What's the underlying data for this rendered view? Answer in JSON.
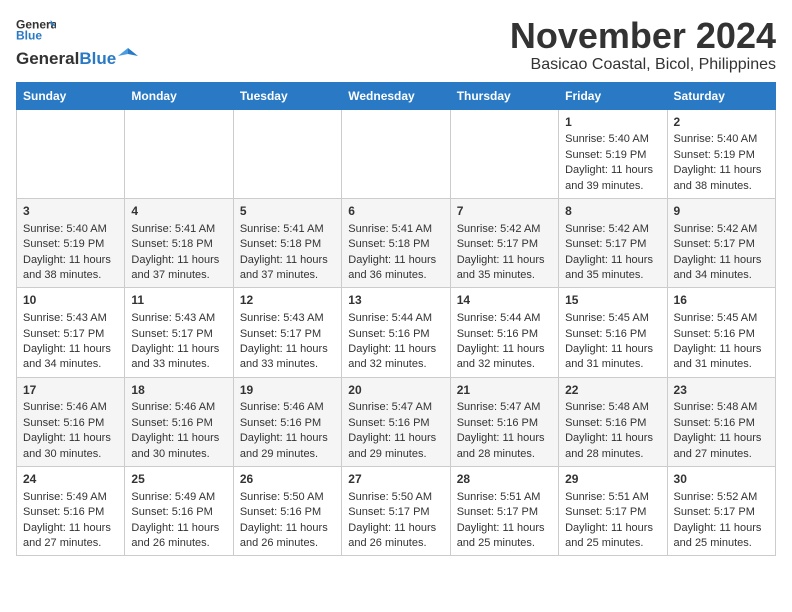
{
  "header": {
    "logo_line1": "General",
    "logo_line2": "Blue",
    "month_year": "November 2024",
    "location": "Basicao Coastal, Bicol, Philippines"
  },
  "weekdays": [
    "Sunday",
    "Monday",
    "Tuesday",
    "Wednesday",
    "Thursday",
    "Friday",
    "Saturday"
  ],
  "weeks": [
    [
      {
        "day": "",
        "info": ""
      },
      {
        "day": "",
        "info": ""
      },
      {
        "day": "",
        "info": ""
      },
      {
        "day": "",
        "info": ""
      },
      {
        "day": "",
        "info": ""
      },
      {
        "day": "1",
        "info": "Sunrise: 5:40 AM\nSunset: 5:19 PM\nDaylight: 11 hours and 39 minutes."
      },
      {
        "day": "2",
        "info": "Sunrise: 5:40 AM\nSunset: 5:19 PM\nDaylight: 11 hours and 38 minutes."
      }
    ],
    [
      {
        "day": "3",
        "info": "Sunrise: 5:40 AM\nSunset: 5:19 PM\nDaylight: 11 hours and 38 minutes."
      },
      {
        "day": "4",
        "info": "Sunrise: 5:41 AM\nSunset: 5:18 PM\nDaylight: 11 hours and 37 minutes."
      },
      {
        "day": "5",
        "info": "Sunrise: 5:41 AM\nSunset: 5:18 PM\nDaylight: 11 hours and 37 minutes."
      },
      {
        "day": "6",
        "info": "Sunrise: 5:41 AM\nSunset: 5:18 PM\nDaylight: 11 hours and 36 minutes."
      },
      {
        "day": "7",
        "info": "Sunrise: 5:42 AM\nSunset: 5:17 PM\nDaylight: 11 hours and 35 minutes."
      },
      {
        "day": "8",
        "info": "Sunrise: 5:42 AM\nSunset: 5:17 PM\nDaylight: 11 hours and 35 minutes."
      },
      {
        "day": "9",
        "info": "Sunrise: 5:42 AM\nSunset: 5:17 PM\nDaylight: 11 hours and 34 minutes."
      }
    ],
    [
      {
        "day": "10",
        "info": "Sunrise: 5:43 AM\nSunset: 5:17 PM\nDaylight: 11 hours and 34 minutes."
      },
      {
        "day": "11",
        "info": "Sunrise: 5:43 AM\nSunset: 5:17 PM\nDaylight: 11 hours and 33 minutes."
      },
      {
        "day": "12",
        "info": "Sunrise: 5:43 AM\nSunset: 5:17 PM\nDaylight: 11 hours and 33 minutes."
      },
      {
        "day": "13",
        "info": "Sunrise: 5:44 AM\nSunset: 5:16 PM\nDaylight: 11 hours and 32 minutes."
      },
      {
        "day": "14",
        "info": "Sunrise: 5:44 AM\nSunset: 5:16 PM\nDaylight: 11 hours and 32 minutes."
      },
      {
        "day": "15",
        "info": "Sunrise: 5:45 AM\nSunset: 5:16 PM\nDaylight: 11 hours and 31 minutes."
      },
      {
        "day": "16",
        "info": "Sunrise: 5:45 AM\nSunset: 5:16 PM\nDaylight: 11 hours and 31 minutes."
      }
    ],
    [
      {
        "day": "17",
        "info": "Sunrise: 5:46 AM\nSunset: 5:16 PM\nDaylight: 11 hours and 30 minutes."
      },
      {
        "day": "18",
        "info": "Sunrise: 5:46 AM\nSunset: 5:16 PM\nDaylight: 11 hours and 30 minutes."
      },
      {
        "day": "19",
        "info": "Sunrise: 5:46 AM\nSunset: 5:16 PM\nDaylight: 11 hours and 29 minutes."
      },
      {
        "day": "20",
        "info": "Sunrise: 5:47 AM\nSunset: 5:16 PM\nDaylight: 11 hours and 29 minutes."
      },
      {
        "day": "21",
        "info": "Sunrise: 5:47 AM\nSunset: 5:16 PM\nDaylight: 11 hours and 28 minutes."
      },
      {
        "day": "22",
        "info": "Sunrise: 5:48 AM\nSunset: 5:16 PM\nDaylight: 11 hours and 28 minutes."
      },
      {
        "day": "23",
        "info": "Sunrise: 5:48 AM\nSunset: 5:16 PM\nDaylight: 11 hours and 27 minutes."
      }
    ],
    [
      {
        "day": "24",
        "info": "Sunrise: 5:49 AM\nSunset: 5:16 PM\nDaylight: 11 hours and 27 minutes."
      },
      {
        "day": "25",
        "info": "Sunrise: 5:49 AM\nSunset: 5:16 PM\nDaylight: 11 hours and 26 minutes."
      },
      {
        "day": "26",
        "info": "Sunrise: 5:50 AM\nSunset: 5:16 PM\nDaylight: 11 hours and 26 minutes."
      },
      {
        "day": "27",
        "info": "Sunrise: 5:50 AM\nSunset: 5:17 PM\nDaylight: 11 hours and 26 minutes."
      },
      {
        "day": "28",
        "info": "Sunrise: 5:51 AM\nSunset: 5:17 PM\nDaylight: 11 hours and 25 minutes."
      },
      {
        "day": "29",
        "info": "Sunrise: 5:51 AM\nSunset: 5:17 PM\nDaylight: 11 hours and 25 minutes."
      },
      {
        "day": "30",
        "info": "Sunrise: 5:52 AM\nSunset: 5:17 PM\nDaylight: 11 hours and 25 minutes."
      }
    ]
  ]
}
